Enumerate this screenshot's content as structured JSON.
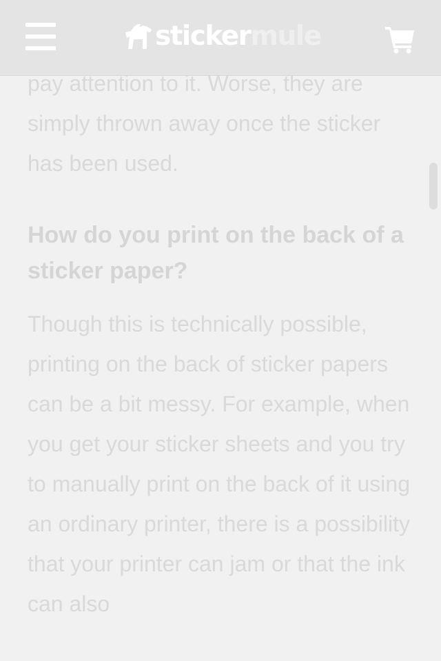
{
  "header": {
    "menu_icon": "hamburger-menu-icon",
    "logo": {
      "part1": "sticker",
      "part2": "mule",
      "icon": "mule-icon"
    },
    "cart_icon": "shopping-cart-icon"
  },
  "article": {
    "intro_lines": "pay attention to it. Worse, they are simply thrown away once the sticker has been used.",
    "heading": "How do you print on the back of a sticker paper?",
    "body": "Though this is technically possible, printing on the back of sticker papers can be a bit messy. For example, when you get your sticker sheets and you try to manually print on the back of it using an ordinary printer, there is a possibility that your printer can jam or that the ink can also"
  },
  "colors": {
    "header_bg": "#e4e4e4",
    "page_bg": "#f1f1f1",
    "text": "#d9d9d9"
  }
}
